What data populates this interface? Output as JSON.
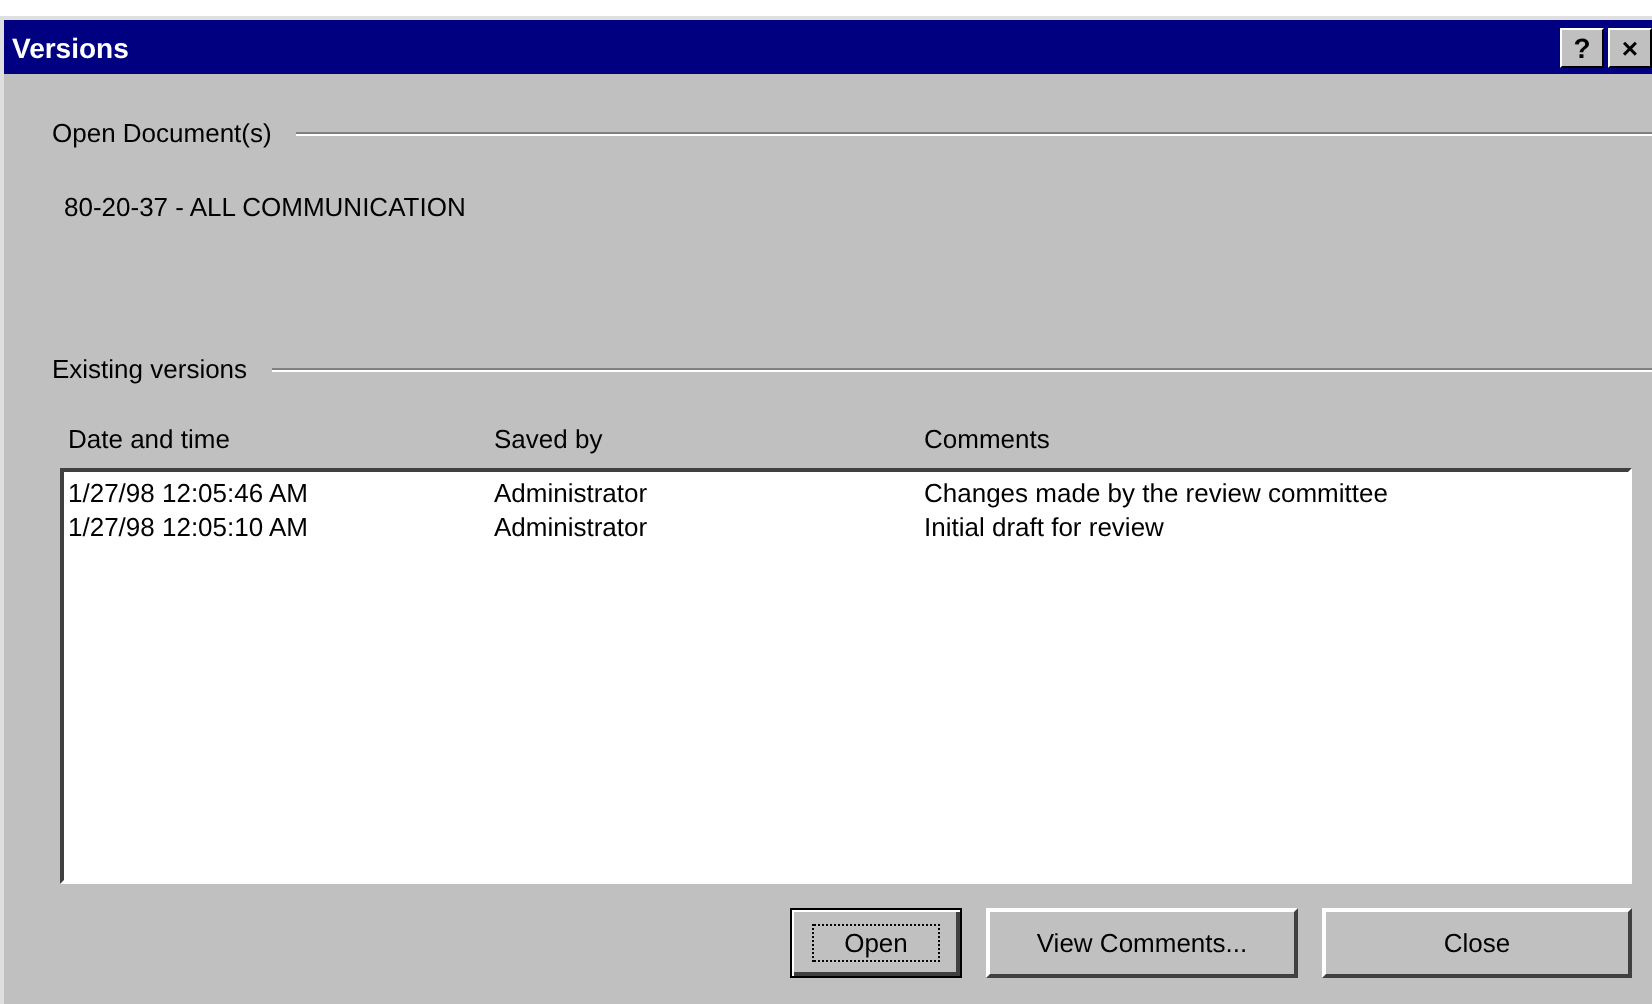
{
  "window": {
    "title": "Versions",
    "title_buttons": [
      "?",
      "×"
    ]
  },
  "open_documents": {
    "label": "Open Document(s)",
    "document": "80-20-37 - ALL COMMUNICATION"
  },
  "existing_versions": {
    "label": "Existing versions",
    "columns": [
      "Date and time",
      "Saved by",
      "Comments"
    ],
    "rows": [
      {
        "cells": [
          "1/27/98 12:05:46 AM",
          "Administrator",
          "Changes made by the review committee"
        ]
      },
      {
        "cells": [
          "1/27/98 12:05:10 AM",
          "Administrator",
          "Initial draft for review"
        ]
      }
    ]
  },
  "buttons": [
    {
      "label": "Open",
      "focused": true
    },
    {
      "label": "View Comments...",
      "focused": false
    },
    {
      "label": "Close",
      "focused": false
    }
  ]
}
